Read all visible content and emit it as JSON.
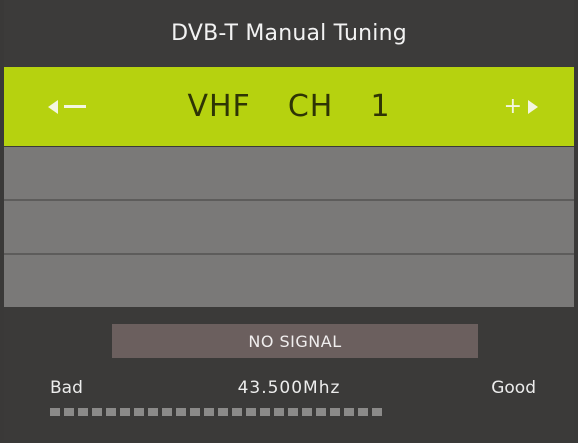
{
  "title": "DVB-T Manual Tuning",
  "selector": {
    "value": "VHF  CH  1",
    "decrease_icon": "triangle-left-minus-icon",
    "increase_icon": "plus-triangle-right-icon"
  },
  "signal": {
    "status": "NO SIGNAL",
    "frequency": "43.500Mhz",
    "low_label": "Bad",
    "high_label": "Good",
    "level_fraction": 0,
    "segment_count": 24
  },
  "colors": {
    "highlight": "#b6d20f",
    "background": "#3b3a39",
    "empty_row": "#7a7978",
    "status_box": "#6b5f5e"
  }
}
